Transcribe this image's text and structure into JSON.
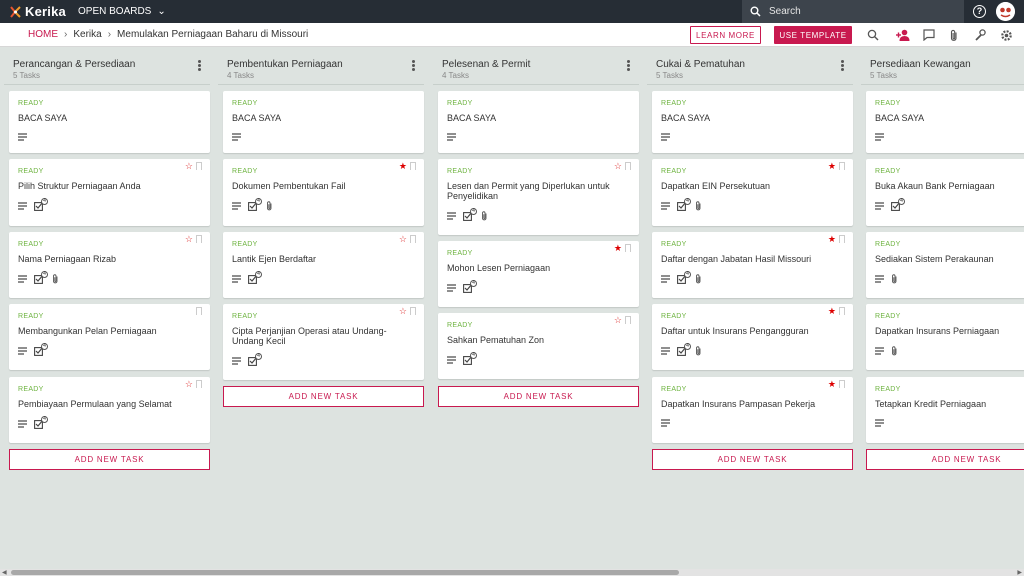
{
  "topbar": {
    "logo": "Kerika",
    "open_boards": "OPEN BOARDS",
    "search_placeholder": "Search"
  },
  "subbar": {
    "home": "HOME",
    "crumb1": "Kerika",
    "crumb2": "Memulakan Perniagaan Baharu di Missouri",
    "learn_more": "LEARN MORE",
    "use_template": "USE TEMPLATE"
  },
  "colors": {
    "accent": "#c8194f",
    "ready": "#6db33f",
    "topbar": "#262d35",
    "board_bg": "#dde3e0"
  },
  "columns": [
    {
      "title": "Perancangan & Persediaan",
      "count": "5 Tasks",
      "add_label": "ADD NEW TASK",
      "cards": [
        {
          "status": "READY",
          "title": "BACA SAYA",
          "star": "none",
          "checklist": "",
          "attach": false
        },
        {
          "status": "READY",
          "title": "Pilih Struktur Perniagaan Anda",
          "star": "empty",
          "checklist": "4",
          "attach": false
        },
        {
          "status": "READY",
          "title": "Nama Perniagaan Rizab",
          "star": "empty",
          "checklist": "4",
          "attach": true
        },
        {
          "status": "READY",
          "title": "Membangunkan Pelan Perniagaan",
          "star": "none",
          "checklist": "4",
          "attach": false
        },
        {
          "status": "READY",
          "title": "Pembiayaan Permulaan yang Selamat",
          "star": "empty",
          "checklist": "4",
          "attach": false
        }
      ]
    },
    {
      "title": "Pembentukan Perniagaan",
      "count": "4 Tasks",
      "add_label": "ADD NEW TASK",
      "cards": [
        {
          "status": "READY",
          "title": "BACA SAYA",
          "star": "none",
          "checklist": "",
          "attach": false
        },
        {
          "status": "READY",
          "title": "Dokumen Pembentukan Fail",
          "star": "filled",
          "checklist": "4",
          "attach": true
        },
        {
          "status": "READY",
          "title": "Lantik Ejen Berdaftar",
          "star": "empty",
          "checklist": "4",
          "attach": false
        },
        {
          "status": "READY",
          "title": "Cipta Perjanjian Operasi atau Undang-Undang Kecil",
          "star": "empty",
          "checklist": "4",
          "attach": false
        }
      ]
    },
    {
      "title": "Pelesenan & Permit",
      "count": "4 Tasks",
      "add_label": "ADD NEW TASK",
      "cards": [
        {
          "status": "READY",
          "title": "BACA SAYA",
          "star": "none",
          "checklist": "",
          "attach": false
        },
        {
          "status": "READY",
          "title": "Lesen dan Permit yang Diperlukan untuk Penyelidikan",
          "star": "empty",
          "checklist": "4",
          "attach": true
        },
        {
          "status": "READY",
          "title": "Mohon Lesen Perniagaan",
          "star": "filled",
          "checklist": "4",
          "attach": false
        },
        {
          "status": "READY",
          "title": "Sahkan Pematuhan Zon",
          "star": "empty",
          "checklist": "4",
          "attach": false
        }
      ]
    },
    {
      "title": "Cukai & Pematuhan",
      "count": "5 Tasks",
      "add_label": "ADD NEW TASK",
      "cards": [
        {
          "status": "READY",
          "title": "BACA SAYA",
          "star": "none",
          "checklist": "",
          "attach": false
        },
        {
          "status": "READY",
          "title": "Dapatkan EIN Persekutuan",
          "star": "filled",
          "checklist": "4",
          "attach": true
        },
        {
          "status": "READY",
          "title": "Daftar dengan Jabatan Hasil Missouri",
          "star": "filled",
          "checklist": "4",
          "attach": true
        },
        {
          "status": "READY",
          "title": "Daftar untuk Insurans Pengangguran",
          "star": "filled",
          "checklist": "4",
          "attach": true
        },
        {
          "status": "READY",
          "title": "Dapatkan Insurans Pampasan Pekerja",
          "star": "filled",
          "checklist": "",
          "attach": false
        }
      ]
    },
    {
      "title": "Persediaan Kewangan",
      "count": "5 Tasks",
      "add_label": "ADD NEW TASK",
      "cards": [
        {
          "status": "READY",
          "title": "BACA SAYA",
          "star": "none",
          "checklist": "",
          "attach": false
        },
        {
          "status": "READY",
          "title": "Buka Akaun Bank Perniagaan",
          "star": "none",
          "checklist": "4",
          "attach": false
        },
        {
          "status": "READY",
          "title": "Sediakan Sistem Perakaunan",
          "star": "none",
          "checklist": "",
          "attach": true
        },
        {
          "status": "READY",
          "title": "Dapatkan Insurans Perniagaan",
          "star": "none",
          "checklist": "",
          "attach": true
        },
        {
          "status": "READY",
          "title": "Tetapkan Kredit Perniagaan",
          "star": "none",
          "checklist": "",
          "attach": false
        }
      ]
    }
  ]
}
